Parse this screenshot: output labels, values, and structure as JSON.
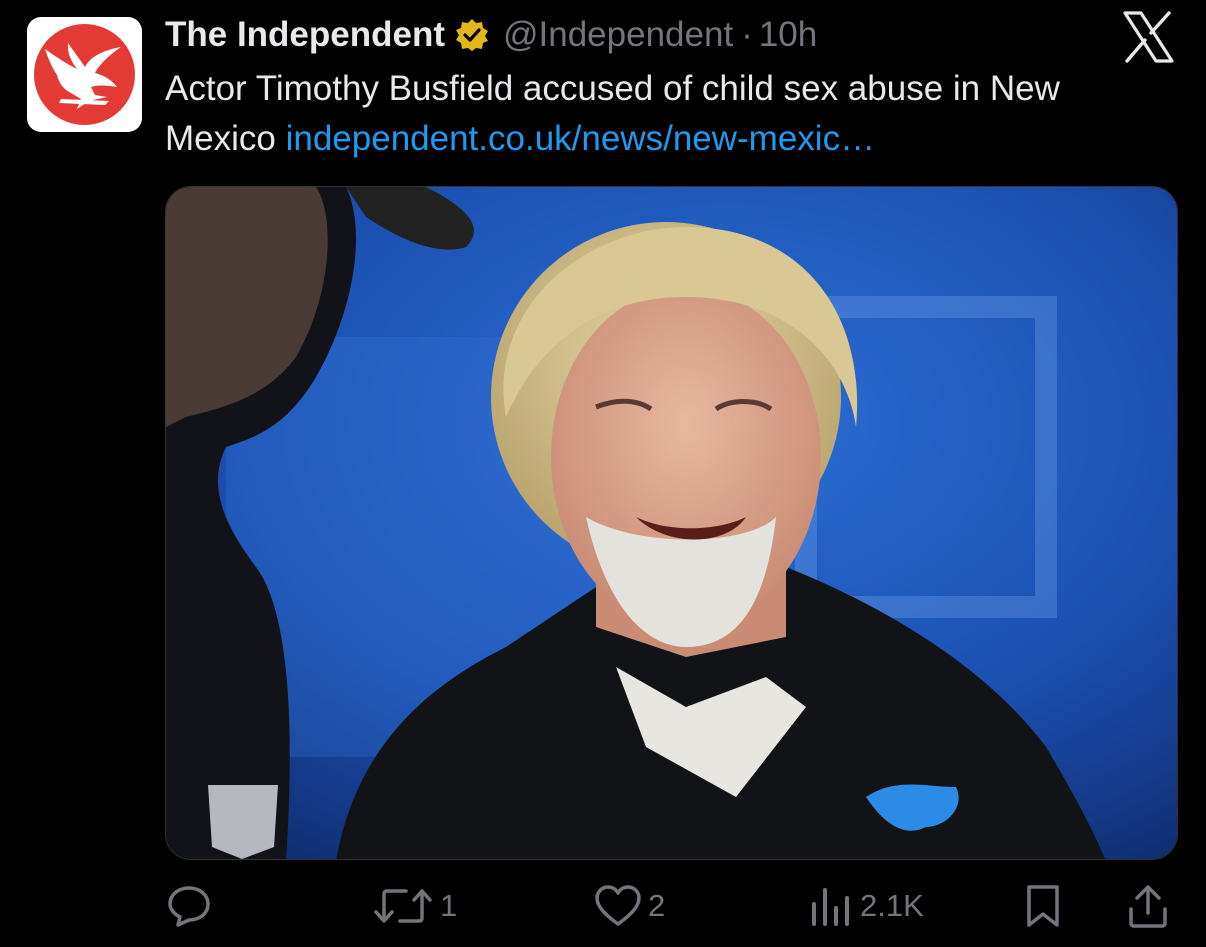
{
  "tweet": {
    "author_name": "The Independent",
    "handle": "@Independent",
    "separator": "·",
    "time": "10h",
    "text": "Actor Timothy Busfield accused of child sex abuse in New Mexico ",
    "link_text": "independent.co.uk/news/new-mexic…",
    "media_icon": "photo",
    "media_description": "A smiling man with curly blond hair and a white beard wearing a black Detroit Lions polo shirt, in front of a blue background."
  },
  "actions": {
    "reply_count": "",
    "retweet_count": "1",
    "like_count": "2",
    "views_count": "2.1K"
  },
  "colors": {
    "background": "#000000",
    "text": "#e7e9ea",
    "muted": "#71767b",
    "link": "#1d9bf0",
    "verified": "#e2b719",
    "brand_red": "#e43a36"
  },
  "icons": {
    "avatar": "eagle-logo",
    "verified": "verified-badge-icon",
    "platform": "x-logo-icon",
    "reply": "reply-icon",
    "retweet": "retweet-icon",
    "like": "heart-icon",
    "views": "views-chart-icon",
    "bookmark": "bookmark-icon",
    "share": "share-icon"
  }
}
